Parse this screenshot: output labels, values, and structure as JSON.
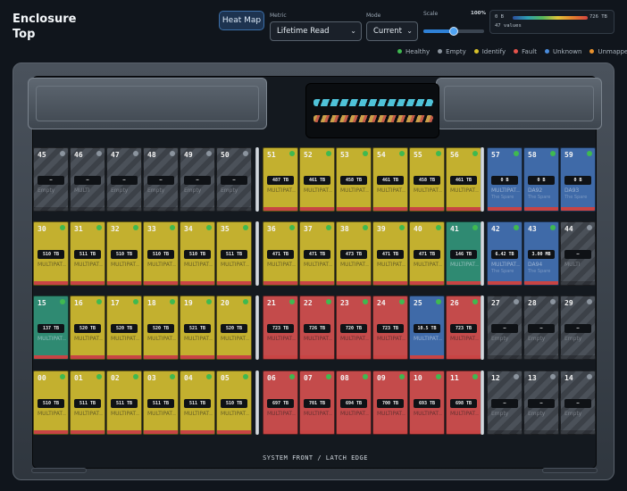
{
  "header": {
    "title_line1": "Enclosure",
    "title_line2": "Top",
    "view_button": "Heat Map",
    "metric_label": "Metric",
    "metric_value": "Lifetime Read",
    "mode_label": "Mode",
    "mode_value": "Current",
    "scale_label": "Scale",
    "scale_percent": "100%",
    "scale_fraction": 0.5,
    "range_min": "0 B",
    "range_max": "726 TB",
    "value_count": "47 values"
  },
  "legend": [
    {
      "label": "Healthy",
      "color": "#3fb950"
    },
    {
      "label": "Empty",
      "color": "#8b949e"
    },
    {
      "label": "Identify",
      "color": "#d7c12a"
    },
    {
      "label": "Fault",
      "color": "#e5534b"
    },
    {
      "label": "Unknown",
      "color": "#4a8bdb"
    },
    {
      "label": "Unmapped",
      "color": "#e8912d"
    }
  ],
  "colors": {
    "yellow": "#c3b02f",
    "red": "#c44b4b",
    "blue": "#3f6aa8",
    "teal": "#2f8a72",
    "empty": "#4a5058",
    "healthy_led": "#3fb950",
    "empty_led": "#8b949e"
  },
  "rows": [
    {
      "left": [
        {
          "id": "45",
          "value": "—",
          "name": "Empty",
          "sub": "",
          "color": "empty"
        },
        {
          "id": "46",
          "value": "—",
          "name": "MULTI",
          "sub": "",
          "color": "empty"
        },
        {
          "id": "47",
          "value": "—",
          "name": "Empty",
          "sub": "",
          "color": "empty"
        },
        {
          "id": "48",
          "value": "—",
          "name": "Empty",
          "sub": "",
          "color": "empty"
        },
        {
          "id": "49",
          "value": "—",
          "name": "Empty",
          "sub": "",
          "color": "empty"
        },
        {
          "id": "50",
          "value": "—",
          "name": "Empty",
          "sub": "",
          "color": "empty"
        }
      ],
      "mid": [
        {
          "id": "51",
          "value": "487 TB",
          "name": "MULTIPAT…",
          "sub": "",
          "color": "yellow"
        },
        {
          "id": "52",
          "value": "461 TB",
          "name": "MULTIPAT…",
          "sub": "",
          "color": "yellow"
        },
        {
          "id": "53",
          "value": "458 TB",
          "name": "MULTIPAT…",
          "sub": "",
          "color": "yellow"
        },
        {
          "id": "54",
          "value": "461 TB",
          "name": "MULTIPAT…",
          "sub": "",
          "color": "yellow"
        },
        {
          "id": "55",
          "value": "458 TB",
          "name": "MULTIPAT…",
          "sub": "",
          "color": "yellow"
        },
        {
          "id": "56",
          "value": "461 TB",
          "name": "MULTIPAT…",
          "sub": "",
          "color": "yellow"
        }
      ],
      "right": [
        {
          "id": "57",
          "value": "0 B",
          "name": "MULTIPAT…",
          "sub": "The Spare",
          "color": "blue"
        },
        {
          "id": "58",
          "value": "0 B",
          "name": "DA92",
          "sub": "The Spare",
          "color": "blue"
        },
        {
          "id": "59",
          "value": "0 B",
          "name": "DA93",
          "sub": "The Spare",
          "color": "blue"
        }
      ]
    },
    {
      "left": [
        {
          "id": "30",
          "value": "510 TB",
          "name": "MULTIPAT…",
          "sub": "",
          "color": "yellow"
        },
        {
          "id": "31",
          "value": "511 TB",
          "name": "MULTIPAT…",
          "sub": "",
          "color": "yellow"
        },
        {
          "id": "32",
          "value": "510 TB",
          "name": "MULTIPAT…",
          "sub": "",
          "color": "yellow"
        },
        {
          "id": "33",
          "value": "510 TB",
          "name": "MULTIPAT…",
          "sub": "",
          "color": "yellow"
        },
        {
          "id": "34",
          "value": "510 TB",
          "name": "MULTIPAT…",
          "sub": "",
          "color": "yellow"
        },
        {
          "id": "35",
          "value": "511 TB",
          "name": "MULTIPAT…",
          "sub": "",
          "color": "yellow"
        }
      ],
      "mid": [
        {
          "id": "36",
          "value": "471 TB",
          "name": "MULTIPAT…",
          "sub": "",
          "color": "yellow"
        },
        {
          "id": "37",
          "value": "471 TB",
          "name": "MULTIPAT…",
          "sub": "",
          "color": "yellow"
        },
        {
          "id": "38",
          "value": "473 TB",
          "name": "MULTIPAT…",
          "sub": "",
          "color": "yellow"
        },
        {
          "id": "39",
          "value": "471 TB",
          "name": "MULTIPAT…",
          "sub": "",
          "color": "yellow"
        },
        {
          "id": "40",
          "value": "471 TB",
          "name": "MULTIPAT…",
          "sub": "",
          "color": "yellow"
        },
        {
          "id": "41",
          "value": "146 TB",
          "name": "MULTIPAT…",
          "sub": "",
          "color": "teal"
        }
      ],
      "right": [
        {
          "id": "42",
          "value": "6.42 TB",
          "name": "MULTIPAT…",
          "sub": "The Spare",
          "color": "blue"
        },
        {
          "id": "43",
          "value": "3.00 MB",
          "name": "DA94",
          "sub": "The Spare",
          "color": "blue"
        },
        {
          "id": "44",
          "value": "—",
          "name": "MULTI",
          "sub": "",
          "color": "empty"
        }
      ]
    },
    {
      "left": [
        {
          "id": "15",
          "value": "137 TB",
          "name": "MULTIPAT…",
          "sub": "",
          "color": "teal"
        },
        {
          "id": "16",
          "value": "520 TB",
          "name": "MULTIPAT…",
          "sub": "",
          "color": "yellow"
        },
        {
          "id": "17",
          "value": "520 TB",
          "name": "MULTIPAT…",
          "sub": "",
          "color": "yellow"
        },
        {
          "id": "18",
          "value": "520 TB",
          "name": "MULTIPAT…",
          "sub": "",
          "color": "yellow"
        },
        {
          "id": "19",
          "value": "521 TB",
          "name": "MULTIPAT…",
          "sub": "",
          "color": "yellow"
        },
        {
          "id": "20",
          "value": "520 TB",
          "name": "MULTIPAT…",
          "sub": "",
          "color": "yellow"
        }
      ],
      "mid": [
        {
          "id": "21",
          "value": "723 TB",
          "name": "MULTIPAT…",
          "sub": "",
          "color": "red"
        },
        {
          "id": "22",
          "value": "726 TB",
          "name": "MULTIPAT…",
          "sub": "",
          "color": "red"
        },
        {
          "id": "23",
          "value": "720 TB",
          "name": "MULTIPAT…",
          "sub": "",
          "color": "red"
        },
        {
          "id": "24",
          "value": "723 TB",
          "name": "MULTIPAT…",
          "sub": "",
          "color": "red"
        },
        {
          "id": "25",
          "value": "10.5 TB",
          "name": "MULTIPAT…",
          "sub": "",
          "color": "blue"
        },
        {
          "id": "26",
          "value": "723 TB",
          "name": "MULTIPAT…",
          "sub": "",
          "color": "red"
        }
      ],
      "right": [
        {
          "id": "27",
          "value": "—",
          "name": "Empty",
          "sub": "",
          "color": "empty"
        },
        {
          "id": "28",
          "value": "—",
          "name": "Empty",
          "sub": "",
          "color": "empty"
        },
        {
          "id": "29",
          "value": "—",
          "name": "Empty",
          "sub": "",
          "color": "empty"
        }
      ]
    },
    {
      "left": [
        {
          "id": "00",
          "value": "510 TB",
          "name": "MULTIPAT…",
          "sub": "",
          "color": "yellow"
        },
        {
          "id": "01",
          "value": "511 TB",
          "name": "MULTIPAT…",
          "sub": "",
          "color": "yellow"
        },
        {
          "id": "02",
          "value": "511 TB",
          "name": "MULTIPAT…",
          "sub": "",
          "color": "yellow"
        },
        {
          "id": "03",
          "value": "511 TB",
          "name": "MULTIPAT…",
          "sub": "",
          "color": "yellow"
        },
        {
          "id": "04",
          "value": "511 TB",
          "name": "MULTIPAT…",
          "sub": "",
          "color": "yellow"
        },
        {
          "id": "05",
          "value": "510 TB",
          "name": "MULTIPAT…",
          "sub": "",
          "color": "yellow"
        }
      ],
      "mid": [
        {
          "id": "06",
          "value": "697 TB",
          "name": "MULTIPAT…",
          "sub": "",
          "color": "red"
        },
        {
          "id": "07",
          "value": "701 TB",
          "name": "MULTIPAT…",
          "sub": "",
          "color": "red"
        },
        {
          "id": "08",
          "value": "694 TB",
          "name": "MULTIPAT…",
          "sub": "",
          "color": "red"
        },
        {
          "id": "09",
          "value": "700 TB",
          "name": "MULTIPAT…",
          "sub": "",
          "color": "red"
        },
        {
          "id": "10",
          "value": "693 TB",
          "name": "MULTIPAT…",
          "sub": "",
          "color": "red"
        },
        {
          "id": "11",
          "value": "698 TB",
          "name": "MULTIPAT…",
          "sub": "",
          "color": "red"
        }
      ],
      "right": [
        {
          "id": "12",
          "value": "—",
          "name": "Empty",
          "sub": "",
          "color": "empty"
        },
        {
          "id": "13",
          "value": "—",
          "name": "Empty",
          "sub": "",
          "color": "empty"
        },
        {
          "id": "14",
          "value": "—",
          "name": "Empty",
          "sub": "",
          "color": "empty"
        }
      ]
    }
  ],
  "footer": {
    "label": "SYSTEM FRONT / LATCH EDGE"
  }
}
